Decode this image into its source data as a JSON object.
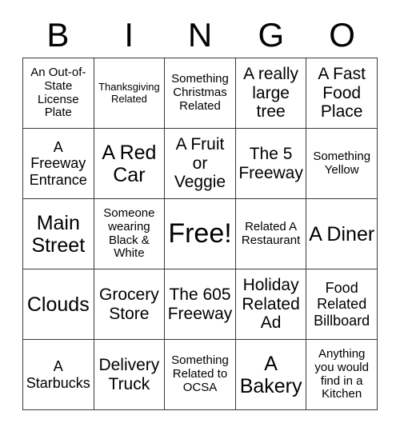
{
  "header": {
    "letters": [
      "B",
      "I",
      "N",
      "G",
      "O"
    ]
  },
  "grid": {
    "rows": [
      [
        {
          "text": "An Out-of-State License Plate",
          "size": "sm"
        },
        {
          "text": "Thanksgiving Related",
          "size": "xs"
        },
        {
          "text": "Something Christmas Related",
          "size": "sm"
        },
        {
          "text": "A really large tree",
          "size": "lg"
        },
        {
          "text": "A Fast Food Place",
          "size": "lg"
        }
      ],
      [
        {
          "text": "A Freeway Entrance",
          "size": "md"
        },
        {
          "text": "A Red Car",
          "size": "xl"
        },
        {
          "text": "A Fruit or Veggie",
          "size": "lg"
        },
        {
          "text": "The 5 Freeway",
          "size": "lg"
        },
        {
          "text": "Something Yellow",
          "size": "sm"
        }
      ],
      [
        {
          "text": "Main Street",
          "size": "xl"
        },
        {
          "text": "Someone wearing Black & White",
          "size": "sm"
        },
        {
          "text": "Free!",
          "size": "free"
        },
        {
          "text": "Related A Restaurant",
          "size": "sm"
        },
        {
          "text": "A Diner",
          "size": "xl"
        }
      ],
      [
        {
          "text": "Clouds",
          "size": "xl"
        },
        {
          "text": "Grocery Store",
          "size": "lg"
        },
        {
          "text": "The 605 Freeway",
          "size": "lg"
        },
        {
          "text": "Holiday Related Ad",
          "size": "lg"
        },
        {
          "text": "Food Related Billboard",
          "size": "md"
        }
      ],
      [
        {
          "text": "A Starbucks",
          "size": "md"
        },
        {
          "text": "Delivery Truck",
          "size": "lg"
        },
        {
          "text": "Something Related to OCSA",
          "size": "sm"
        },
        {
          "text": "A Bakery",
          "size": "xl"
        },
        {
          "text": "Anything you would find in a Kitchen",
          "size": "sm"
        }
      ]
    ]
  },
  "colors": {
    "border": "#3a3a3a",
    "text": "#000000",
    "background": "#ffffff"
  }
}
